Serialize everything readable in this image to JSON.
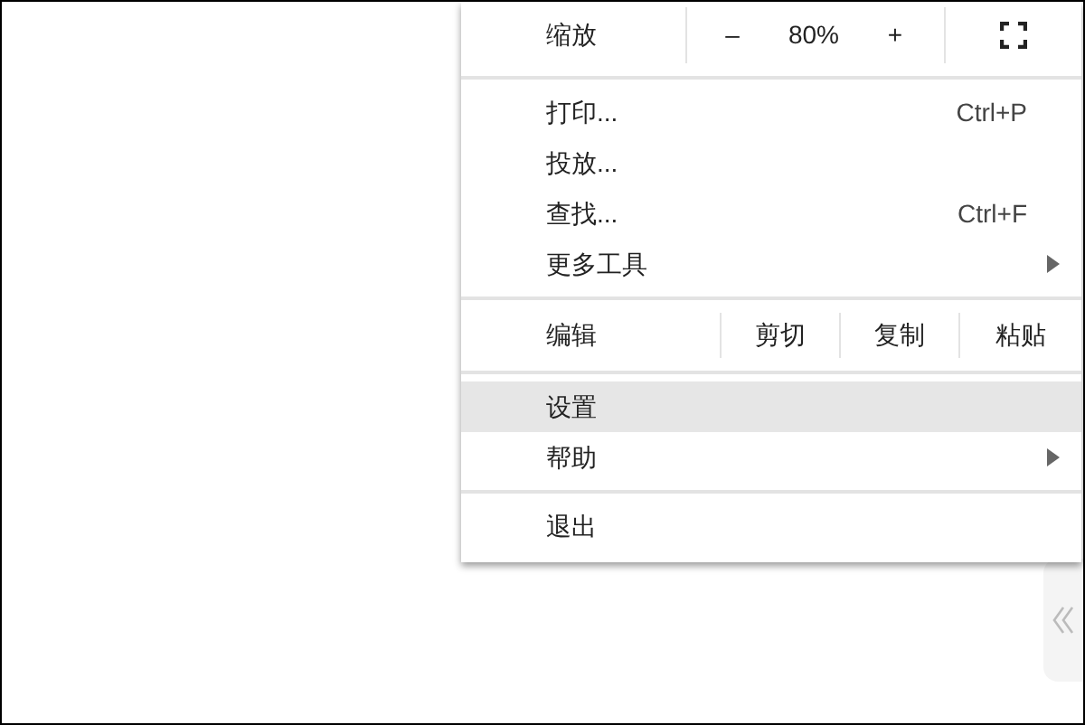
{
  "menu": {
    "items": [
      {
        "kind": "zoom",
        "label": "缩放",
        "decrease": "–",
        "value": "80%",
        "increase": "+"
      },
      {
        "kind": "separator"
      },
      {
        "kind": "item",
        "label": "打印...",
        "shortcut": "Ctrl+P",
        "selected": false
      },
      {
        "kind": "item",
        "label": "投放...",
        "selected": false
      },
      {
        "kind": "item",
        "label": "查找...",
        "shortcut": "Ctrl+F",
        "selected": false
      },
      {
        "kind": "submenu",
        "label": "更多工具",
        "selected": false
      },
      {
        "kind": "separator"
      },
      {
        "kind": "edit",
        "label": "编辑",
        "actions": [
          "剪切",
          "复制",
          "粘贴"
        ]
      },
      {
        "kind": "separator"
      },
      {
        "kind": "item",
        "label": "设置",
        "selected": true
      },
      {
        "kind": "submenu",
        "label": "帮助",
        "selected": false
      },
      {
        "kind": "separator"
      },
      {
        "kind": "item",
        "label": "退出",
        "selected": false
      }
    ]
  }
}
